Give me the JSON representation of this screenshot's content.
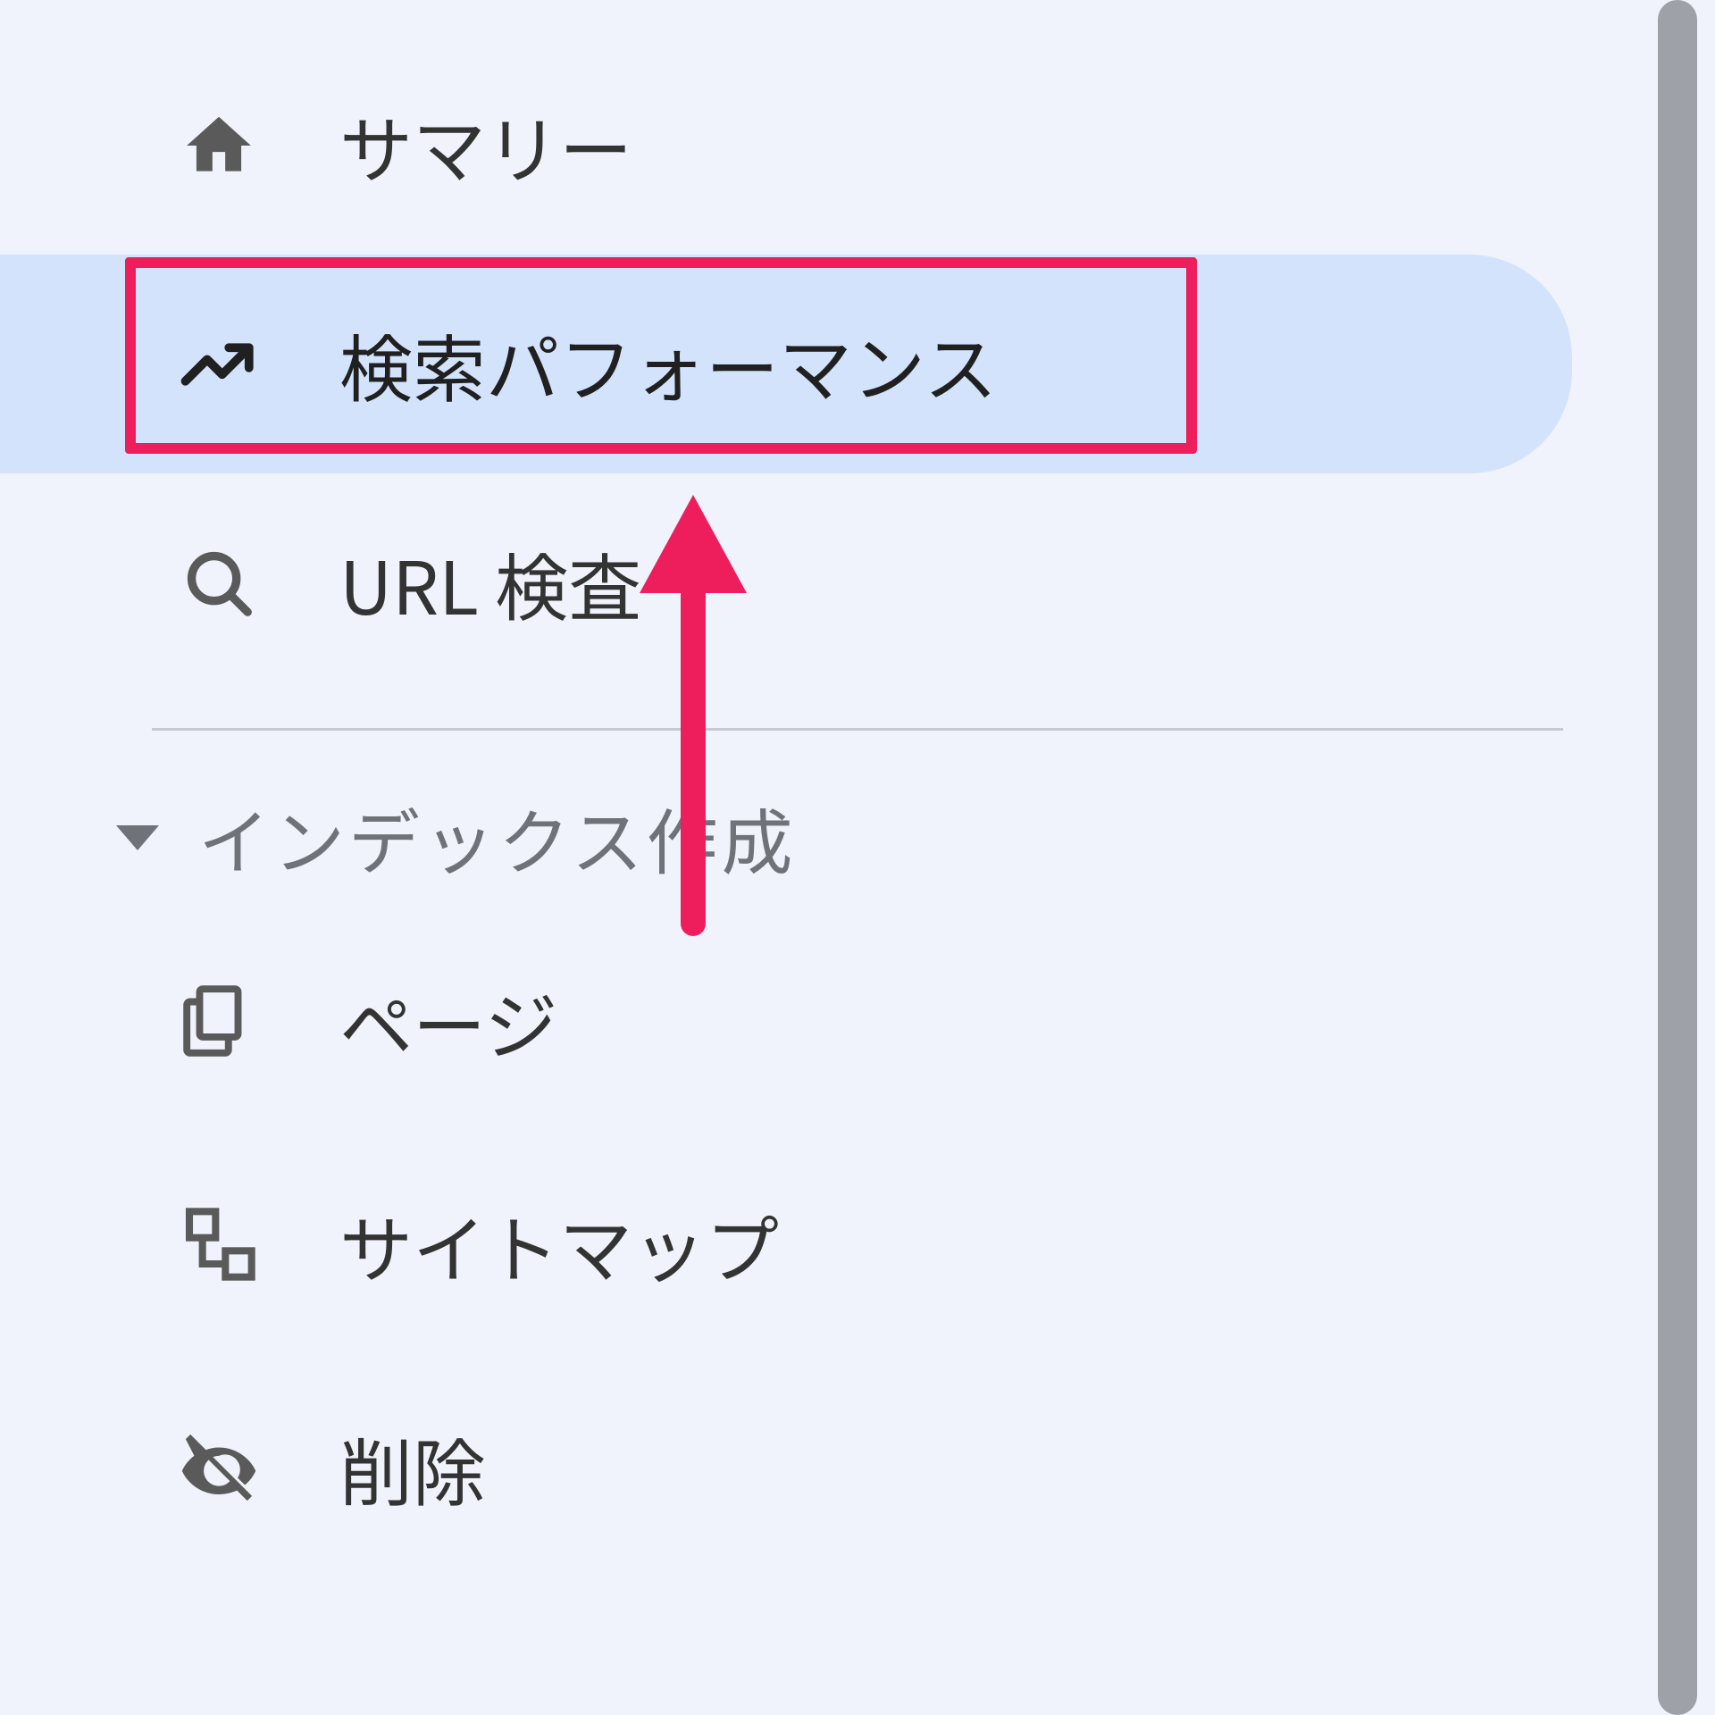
{
  "colors": {
    "highlight": "#ed1e5b",
    "active_bg": "#d3e3fc",
    "page_bg": "#f0f3fb",
    "text": "#333333",
    "muted": "#6f7278"
  },
  "sidebar": {
    "top_items": [
      {
        "icon_name": "home-icon",
        "label": "サマリー",
        "active": false
      },
      {
        "icon_name": "trending-icon",
        "label": "検索パフォーマンス",
        "active": true
      },
      {
        "icon_name": "search-icon",
        "label": "URL 検査",
        "active": false
      }
    ],
    "section": {
      "title": "インデックス作成",
      "items": [
        {
          "icon_name": "pages-icon",
          "label": "ページ"
        },
        {
          "icon_name": "sitemap-icon",
          "label": "サイトマップ"
        },
        {
          "icon_name": "visibility-off-icon",
          "label": "削除"
        }
      ]
    }
  },
  "annotation": {
    "highlight_target": "検索パフォーマンス",
    "arrow_pointing": "up"
  }
}
